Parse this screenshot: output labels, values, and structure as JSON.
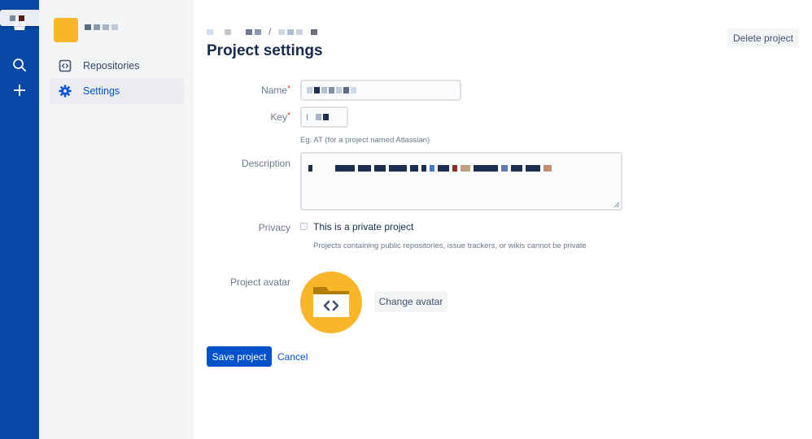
{
  "global_nav": {
    "icons": [
      "bitbucket-logo-icon",
      "search-icon",
      "create-plus-icon"
    ]
  },
  "sidebar": {
    "items": [
      {
        "label": "Repositories",
        "icon": "repository-icon",
        "active": false
      },
      {
        "label": "Settings",
        "icon": "gear-icon",
        "active": true
      }
    ]
  },
  "header": {
    "title": "Project settings",
    "delete_label": "Delete project"
  },
  "form": {
    "name_label": "Name",
    "key_label": "Key",
    "key_hint": "Eg. AT (for a project named Atlassian)",
    "description_label": "Description",
    "privacy_label": "Privacy",
    "private_checkbox_label": "This is a private project",
    "private_checked": false,
    "privacy_hint": "Projects containing public repositories, issue trackers, or wikis cannot be private",
    "avatar_label": "Project avatar",
    "change_avatar_label": "Change avatar",
    "save_label": "Save project",
    "cancel_label": "Cancel"
  },
  "colors": {
    "nav": "#0747A6",
    "primary": "#0052CC",
    "avatar": "#F9B62B",
    "required": "#DE350B"
  }
}
